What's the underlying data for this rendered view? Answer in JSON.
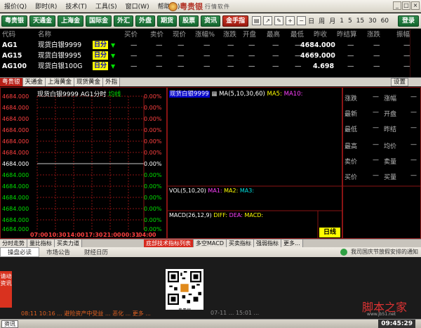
{
  "menu": {
    "items": [
      "报价(Q)",
      "即时(R)",
      "技术(T)",
      "工具(S)",
      "窗口(W)",
      "帮助(H)"
    ],
    "brand": "粤贵银",
    "brand_sub": "行情软件"
  },
  "toolbar": {
    "buttons": [
      "粤贵银",
      "天通金",
      "上海金",
      "国际金",
      "外汇",
      "外盘",
      "期货",
      "股票",
      "资讯",
      "金手指"
    ],
    "periods": [
      "日",
      "周",
      "月",
      "1",
      "5",
      "15",
      "30",
      "60"
    ],
    "login": "登录"
  },
  "quote": {
    "headers": [
      "代码",
      "名称",
      "买价",
      "卖价",
      "现价",
      "涨幅%",
      "涨跌",
      "开盘",
      "最高",
      "最低",
      "昨收",
      "昨结算",
      "涨跌",
      "振幅"
    ],
    "rows": [
      {
        "code": "AG1",
        "name": "现货白银9999",
        "tag": "日分",
        "prev": "4684.000"
      },
      {
        "code": "AG15",
        "name": "现货白银9995",
        "tag": "日分",
        "prev": "4669.000"
      },
      {
        "code": "AG100",
        "name": "现货白银100G",
        "tag": "日分",
        "prev": "4.698"
      }
    ],
    "dash": "—"
  },
  "tabs": [
    "粤贵银",
    "天通金",
    "上海黄金",
    "现货黄金",
    "外指"
  ],
  "settings": "设置",
  "intraday": {
    "title": "现货白银9999 AG1分时",
    "avg_label": "均线",
    "y_labels": [
      "4684.000",
      "4684.000",
      "4684.000",
      "4684.000",
      "4684.000",
      "4684.000",
      "4684.000",
      "4684.000",
      "4684.000",
      "4684.000",
      "4684.000",
      "4684.000",
      "4684.000"
    ],
    "pct_labels": [
      "0.00%",
      "0.00%",
      "0.00%",
      "0.00%",
      "0.00%",
      "0.00%",
      "0.00%",
      "0.00%",
      "0.00%",
      "0.00%",
      "0.00%",
      "0.00%",
      "0.00%"
    ],
    "x_labels": [
      "07:00",
      "10:30",
      "14:00",
      "17:30",
      "21:00",
      "00:31",
      "04:00"
    ]
  },
  "kline": {
    "name": "现货白银9999",
    "ma": "MA(5,10,30,60)",
    "ma5": "MA5:",
    "ma10": "MA10:",
    "vol": "VOL(5,10,20)",
    "vol_ma1": "MA1:",
    "vol_ma2": "MA2:",
    "vol_ma3": "MA3:",
    "macd": "MACD(26,12,9)",
    "diff": "DIFF:",
    "dea": "DEA:",
    "macd_val": "MACD:",
    "period_btn": "日线"
  },
  "detail": {
    "rows": [
      [
        "涨跌",
        "—",
        "涨幅",
        "—"
      ],
      [
        "最新",
        "—",
        "开盘",
        "—"
      ],
      [
        "最低",
        "—",
        "昨结",
        "—"
      ],
      [
        "最高",
        "—",
        "均价",
        "—"
      ],
      [
        "卖价",
        "—",
        "卖量",
        "—"
      ],
      [
        "买价",
        "—",
        "买量",
        "—"
      ]
    ]
  },
  "lower_tabs_left": [
    "分时走势",
    "量比指标",
    "买卖力道"
  ],
  "lower_tabs_right": [
    "底部技术指标列表",
    "多空MACD",
    "买卖指标",
    "强弱指标",
    "更多..."
  ],
  "news": {
    "tabs": [
      "操盘必读",
      "市场公告",
      "财经日历"
    ],
    "marquee": "我司国庆节放假安排的通知",
    "ticker_left": "08:11 10:16 ... 避险资产中受益 ... 恶化 ... 更多 ...",
    "ticker_right": "07-11 ... 15:01 ..."
  },
  "side_ad": "请动资讯",
  "qr_caption": "粤贵银",
  "watermark": "脚本之家",
  "watermark_url": "www.jb51.net",
  "status": {
    "news_btn": "资讯",
    "clock": "09:45:29"
  },
  "colors": {
    "bg": "#000000",
    "grid": "#8a1414",
    "up": "#ff4040",
    "down": "#00e000",
    "tag": "#ffff00"
  }
}
